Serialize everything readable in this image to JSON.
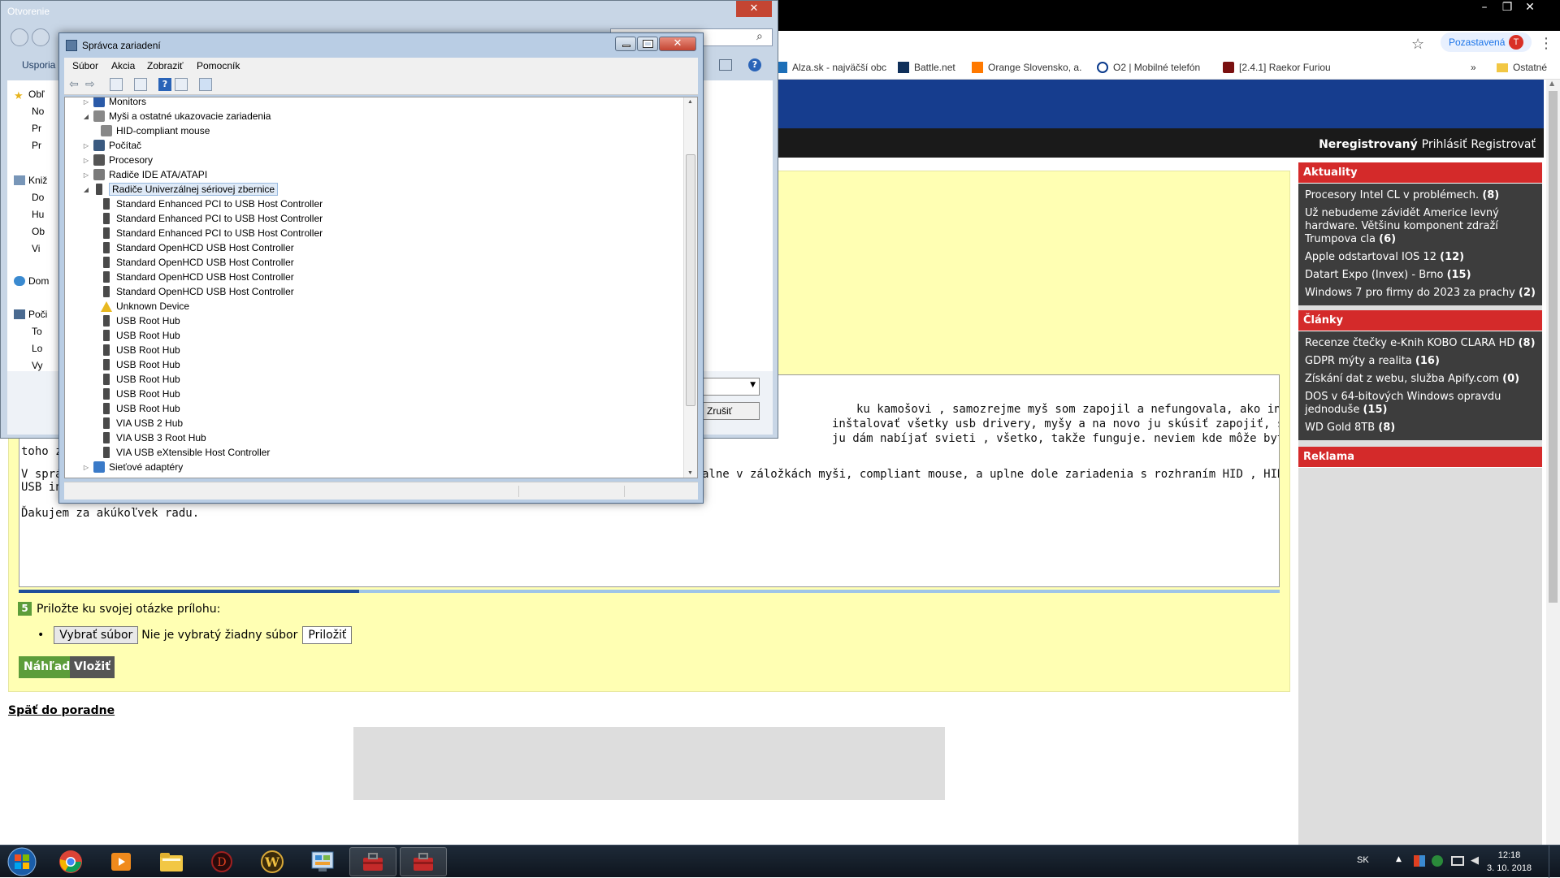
{
  "chrome": {
    "paused_label": "Pozastavená",
    "avatar_letter": "T",
    "bookmarks": [
      {
        "label": "Alza.sk - najväčší obc"
      },
      {
        "label": "Battle.net"
      },
      {
        "label": "Orange Slovensko, a."
      },
      {
        "label": "O2 | Mobilné telefón"
      },
      {
        "label": "[2.4.1] Raekor Furiou"
      }
    ],
    "bookmarks_more": "»",
    "other_bookmarks": "Ostatné"
  },
  "site": {
    "user_status": "Neregistrovaný",
    "login": "Prihlásiť",
    "register": "Registrovať",
    "textarea_lines": [
      "ku kamošovi , samozrejme myš som zapojil a nefungovala, ako inak. tak som tam mal inú a",
      "inštalovať všetky usb drivery, myšy a na novo ju skúsiť zapojiť, stále nefunguje, a mám",
      "ju dám nabíjať svieti , všetko, takže funguje. neviem kde môže byť problém, už som z",
      "toho zu",
      "V sprá",
      "alne v záložkách myši, compliant mouse, a uplne dole zariadenia s rozhraním HID , HID compliant device a",
      "USB in",
      "Ďakujem za akúkoľvek radu."
    ],
    "step_number": "5",
    "attach_label": "Priložte ku svojej otázke prílohu:",
    "choose_file": "Vybrať súbor",
    "no_file": "Nie je vybratý žiadny súbor",
    "attach_btn": "Priložiť",
    "preview_btn": "Náhľad",
    "insert_btn": "Vložiť",
    "back_link": "Späť do poradne",
    "sidebar": {
      "news_title": "Aktuality",
      "news": [
        {
          "text": "Procesory Intel CL v problémech.",
          "count": "(8)"
        },
        {
          "text": "Už nebudeme závidět Americe levný hardware. Většinu komponent zdraží Trumpova cla",
          "count": "(6)"
        },
        {
          "text": "Apple odstartoval IOS 12",
          "count": "(12)"
        },
        {
          "text": "Datart Expo (Invex) - Brno",
          "count": "(15)"
        },
        {
          "text": "Windows 7 pro firmy do 2023 za prachy",
          "count": "(2)"
        }
      ],
      "articles_title": "Články",
      "articles": [
        {
          "text": "Recenze čtečky e-Knih KOBO CLARA HD",
          "count": "(8)"
        },
        {
          "text": "GDPR mýty a realita",
          "count": "(16)"
        },
        {
          "text": "Získání dat z webu, služba Apify.com",
          "count": "(0)"
        },
        {
          "text": "DOS v 64-bitových Windows opravdu jednoduše",
          "count": "(15)"
        },
        {
          "text": "WD Gold 8TB",
          "count": "(8)"
        }
      ],
      "ads_title": "Reklama"
    }
  },
  "open_dialog": {
    "title": "Otvorenie",
    "organize": "Usporia",
    "nav": [
      {
        "label": "Obľ"
      },
      {
        "label": "No"
      },
      {
        "label": "Pr"
      },
      {
        "label": "Pr"
      },
      {
        "label": "Kniž"
      },
      {
        "label": "Do"
      },
      {
        "label": "Hu"
      },
      {
        "label": "Ob"
      },
      {
        "label": "Vi"
      },
      {
        "label": "Dom"
      },
      {
        "label": "Poči"
      },
      {
        "label": "To"
      },
      {
        "label": "Lo"
      },
      {
        "label": "Vy"
      }
    ],
    "cancel": "Zrušiť"
  },
  "devmgr": {
    "title": "Správca zariadení",
    "menu": [
      "Súbor",
      "Akcia",
      "Zobraziť",
      "Pomocník"
    ],
    "tree": [
      {
        "label": "Monitors",
        "level": 1,
        "expanded": false,
        "icon": "monitor"
      },
      {
        "label": "Myši a ostatné ukazovacie zariadenia",
        "level": 1,
        "expanded": true,
        "icon": "mouse"
      },
      {
        "label": "HID-compliant mouse",
        "level": 2,
        "icon": "mouse"
      },
      {
        "label": "Počítač",
        "level": 1,
        "expanded": false,
        "icon": "computer"
      },
      {
        "label": "Procesory",
        "level": 1,
        "expanded": false,
        "icon": "cpu"
      },
      {
        "label": "Radiče IDE ATA/ATAPI",
        "level": 1,
        "expanded": false,
        "icon": "ide"
      },
      {
        "label": "Radiče Univerzálnej sériovej zbernice",
        "level": 1,
        "expanded": true,
        "icon": "usb",
        "selected": true
      },
      {
        "label": "Standard Enhanced PCI to USB Host Controller",
        "level": 2,
        "icon": "usb"
      },
      {
        "label": "Standard Enhanced PCI to USB Host Controller",
        "level": 2,
        "icon": "usb"
      },
      {
        "label": "Standard Enhanced PCI to USB Host Controller",
        "level": 2,
        "icon": "usb"
      },
      {
        "label": "Standard OpenHCD USB Host Controller",
        "level": 2,
        "icon": "usb"
      },
      {
        "label": "Standard OpenHCD USB Host Controller",
        "level": 2,
        "icon": "usb"
      },
      {
        "label": "Standard OpenHCD USB Host Controller",
        "level": 2,
        "icon": "usb"
      },
      {
        "label": "Standard OpenHCD USB Host Controller",
        "level": 2,
        "icon": "usb"
      },
      {
        "label": "Unknown Device",
        "level": 2,
        "icon": "warning"
      },
      {
        "label": "USB Root Hub",
        "level": 2,
        "icon": "usb"
      },
      {
        "label": "USB Root Hub",
        "level": 2,
        "icon": "usb"
      },
      {
        "label": "USB Root Hub",
        "level": 2,
        "icon": "usb"
      },
      {
        "label": "USB Root Hub",
        "level": 2,
        "icon": "usb"
      },
      {
        "label": "USB Root Hub",
        "level": 2,
        "icon": "usb"
      },
      {
        "label": "USB Root Hub",
        "level": 2,
        "icon": "usb"
      },
      {
        "label": "USB Root Hub",
        "level": 2,
        "icon": "usb"
      },
      {
        "label": "VIA USB 2 Hub",
        "level": 2,
        "icon": "usb"
      },
      {
        "label": "VIA USB 3 Root Hub",
        "level": 2,
        "icon": "usb"
      },
      {
        "label": "VIA USB eXtensible Host Controller",
        "level": 2,
        "icon": "usb"
      },
      {
        "label": "Sieťové adaptéry",
        "level": 1,
        "expanded": false,
        "icon": "network"
      }
    ]
  },
  "taskbar": {
    "language": "SK",
    "time": "12:18",
    "date": "3. 10. 2018"
  },
  "colors": {
    "site_header": "#163d8e",
    "sidebar_red": "#d42a2a",
    "yellow_bg": "#ffffb3",
    "button_green": "#5c9d3a"
  }
}
